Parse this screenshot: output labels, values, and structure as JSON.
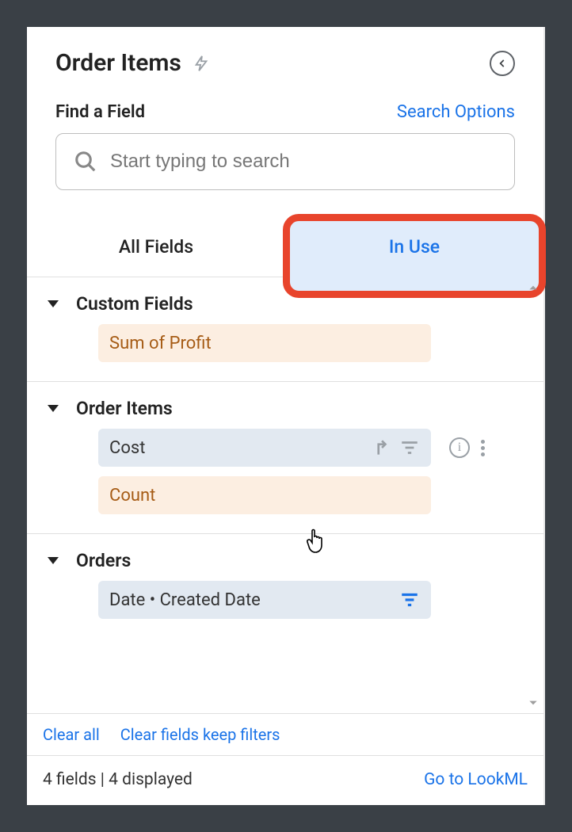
{
  "header": {
    "title": "Order Items"
  },
  "search": {
    "find_label": "Find a Field",
    "options_label": "Search Options",
    "placeholder": "Start typing to search"
  },
  "tabs": {
    "all_fields": "All Fields",
    "in_use": "In Use"
  },
  "sections": [
    {
      "title": "Custom Fields",
      "fields": [
        {
          "label": "Sum of Profit",
          "style": "orange"
        }
      ]
    },
    {
      "title": "Order Items",
      "fields": [
        {
          "label": "Cost",
          "style": "blue",
          "show_pivot": true,
          "show_filter": true,
          "show_info": true,
          "show_kebab": true
        },
        {
          "label": "Count",
          "style": "orange"
        }
      ]
    },
    {
      "title": "Orders",
      "fields": [
        {
          "label": "Date • Created Date",
          "style": "blue",
          "show_filter_active": true
        }
      ]
    }
  ],
  "footer": {
    "clear_all": "Clear all",
    "clear_keep": "Clear fields keep filters",
    "status_left": "4 fields | 4 displayed",
    "go_lookml": "Go to LookML"
  }
}
